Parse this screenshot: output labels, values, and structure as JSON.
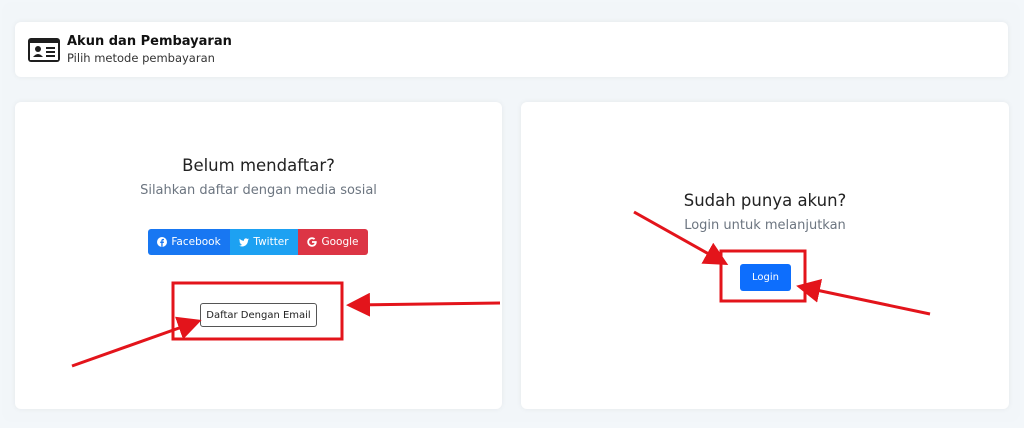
{
  "header": {
    "title": "Akun dan Pembayaran",
    "subtitle": "Pilih metode pembayaran",
    "icon": "id-card-icon"
  },
  "register": {
    "title": "Belum mendaftar?",
    "subtitle": "Silahkan daftar dengan media sosial",
    "social_buttons": {
      "facebook": "Facebook",
      "twitter": "Twitter",
      "google": "Google"
    },
    "email_button": "Daftar Dengan Email"
  },
  "login": {
    "title": "Sudah punya akun?",
    "subtitle": "Login untuk melanjutkan",
    "button": "Login"
  },
  "colors": {
    "facebook": "#1877f2",
    "twitter": "#1da1f2",
    "google": "#dc3545",
    "login": "#0d6efd",
    "annotation": "#e3141b"
  }
}
